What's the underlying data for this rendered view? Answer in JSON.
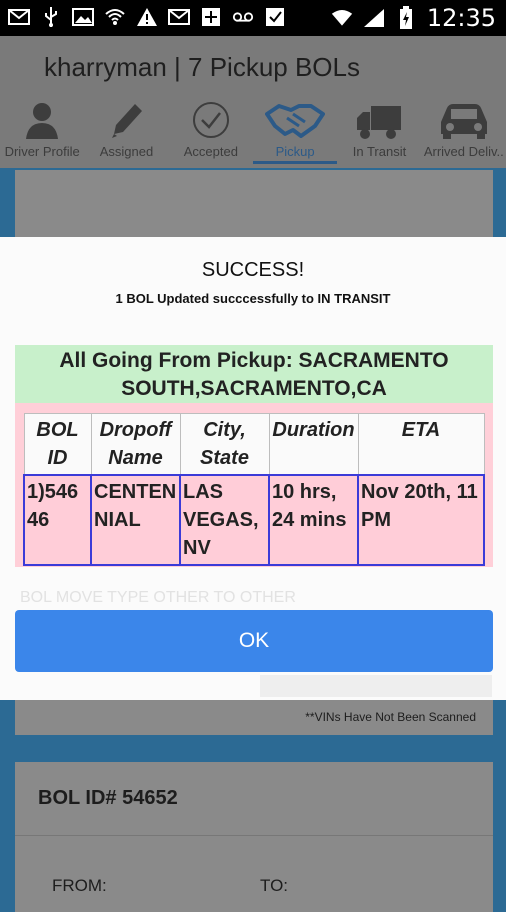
{
  "status_bar": {
    "time": "12:35",
    "icons": [
      "mail-icon",
      "usb-icon",
      "image-icon",
      "wifi-icon",
      "warning-icon",
      "mail-icon",
      "calendar-plus-icon",
      "voicemail-icon",
      "checkbox-icon"
    ],
    "right_icons": [
      "wifi-signal-icon",
      "cell-signal-icon",
      "battery-icon"
    ]
  },
  "app": {
    "title": "kharryman | 7 Pickup BOLs",
    "tabs": [
      {
        "label": "Driver Profile",
        "icon": "person-icon"
      },
      {
        "label": "Assigned",
        "icon": "pencil-icon"
      },
      {
        "label": "Accepted",
        "icon": "check-circle-icon"
      },
      {
        "label": "Pickup",
        "icon": "handshake-icon",
        "active": true
      },
      {
        "label": "In Transit",
        "icon": "truck-icon"
      },
      {
        "label": "Arrived Deliv..",
        "icon": "car-icon"
      }
    ],
    "vins_note": "**VINs Have Not Been Scanned",
    "card_bol_id": "BOL ID# 54652",
    "from_label": "FROM:",
    "to_label": "TO:"
  },
  "dialog": {
    "title": "SUCCESS!",
    "subtitle": "1 BOL Updated succcessfully to IN TRANSIT",
    "pickup_header": "All Going From Pickup: SACRAMENTO SOUTH,SACRAMENTO,CA",
    "table": {
      "headers": [
        "BOL ID",
        "Dropoff Name",
        "City, State",
        "Duration",
        "ETA"
      ],
      "rows": [
        [
          "1)54646",
          "CENTENNIAL",
          "LAS VEGAS, NV",
          "10 hrs, 24 mins",
          "Nov 20th, 11 PM"
        ]
      ]
    },
    "faded_text": "BOL MOVE TYPE OTHER TO OTHER",
    "ok_label": "OK"
  },
  "colors": {
    "ok_button": "#3b86ea",
    "pickup_header_bg": "#c8f0cb",
    "table_row_bg": "#ffcdd8",
    "active_tab": "#2c5a88"
  }
}
